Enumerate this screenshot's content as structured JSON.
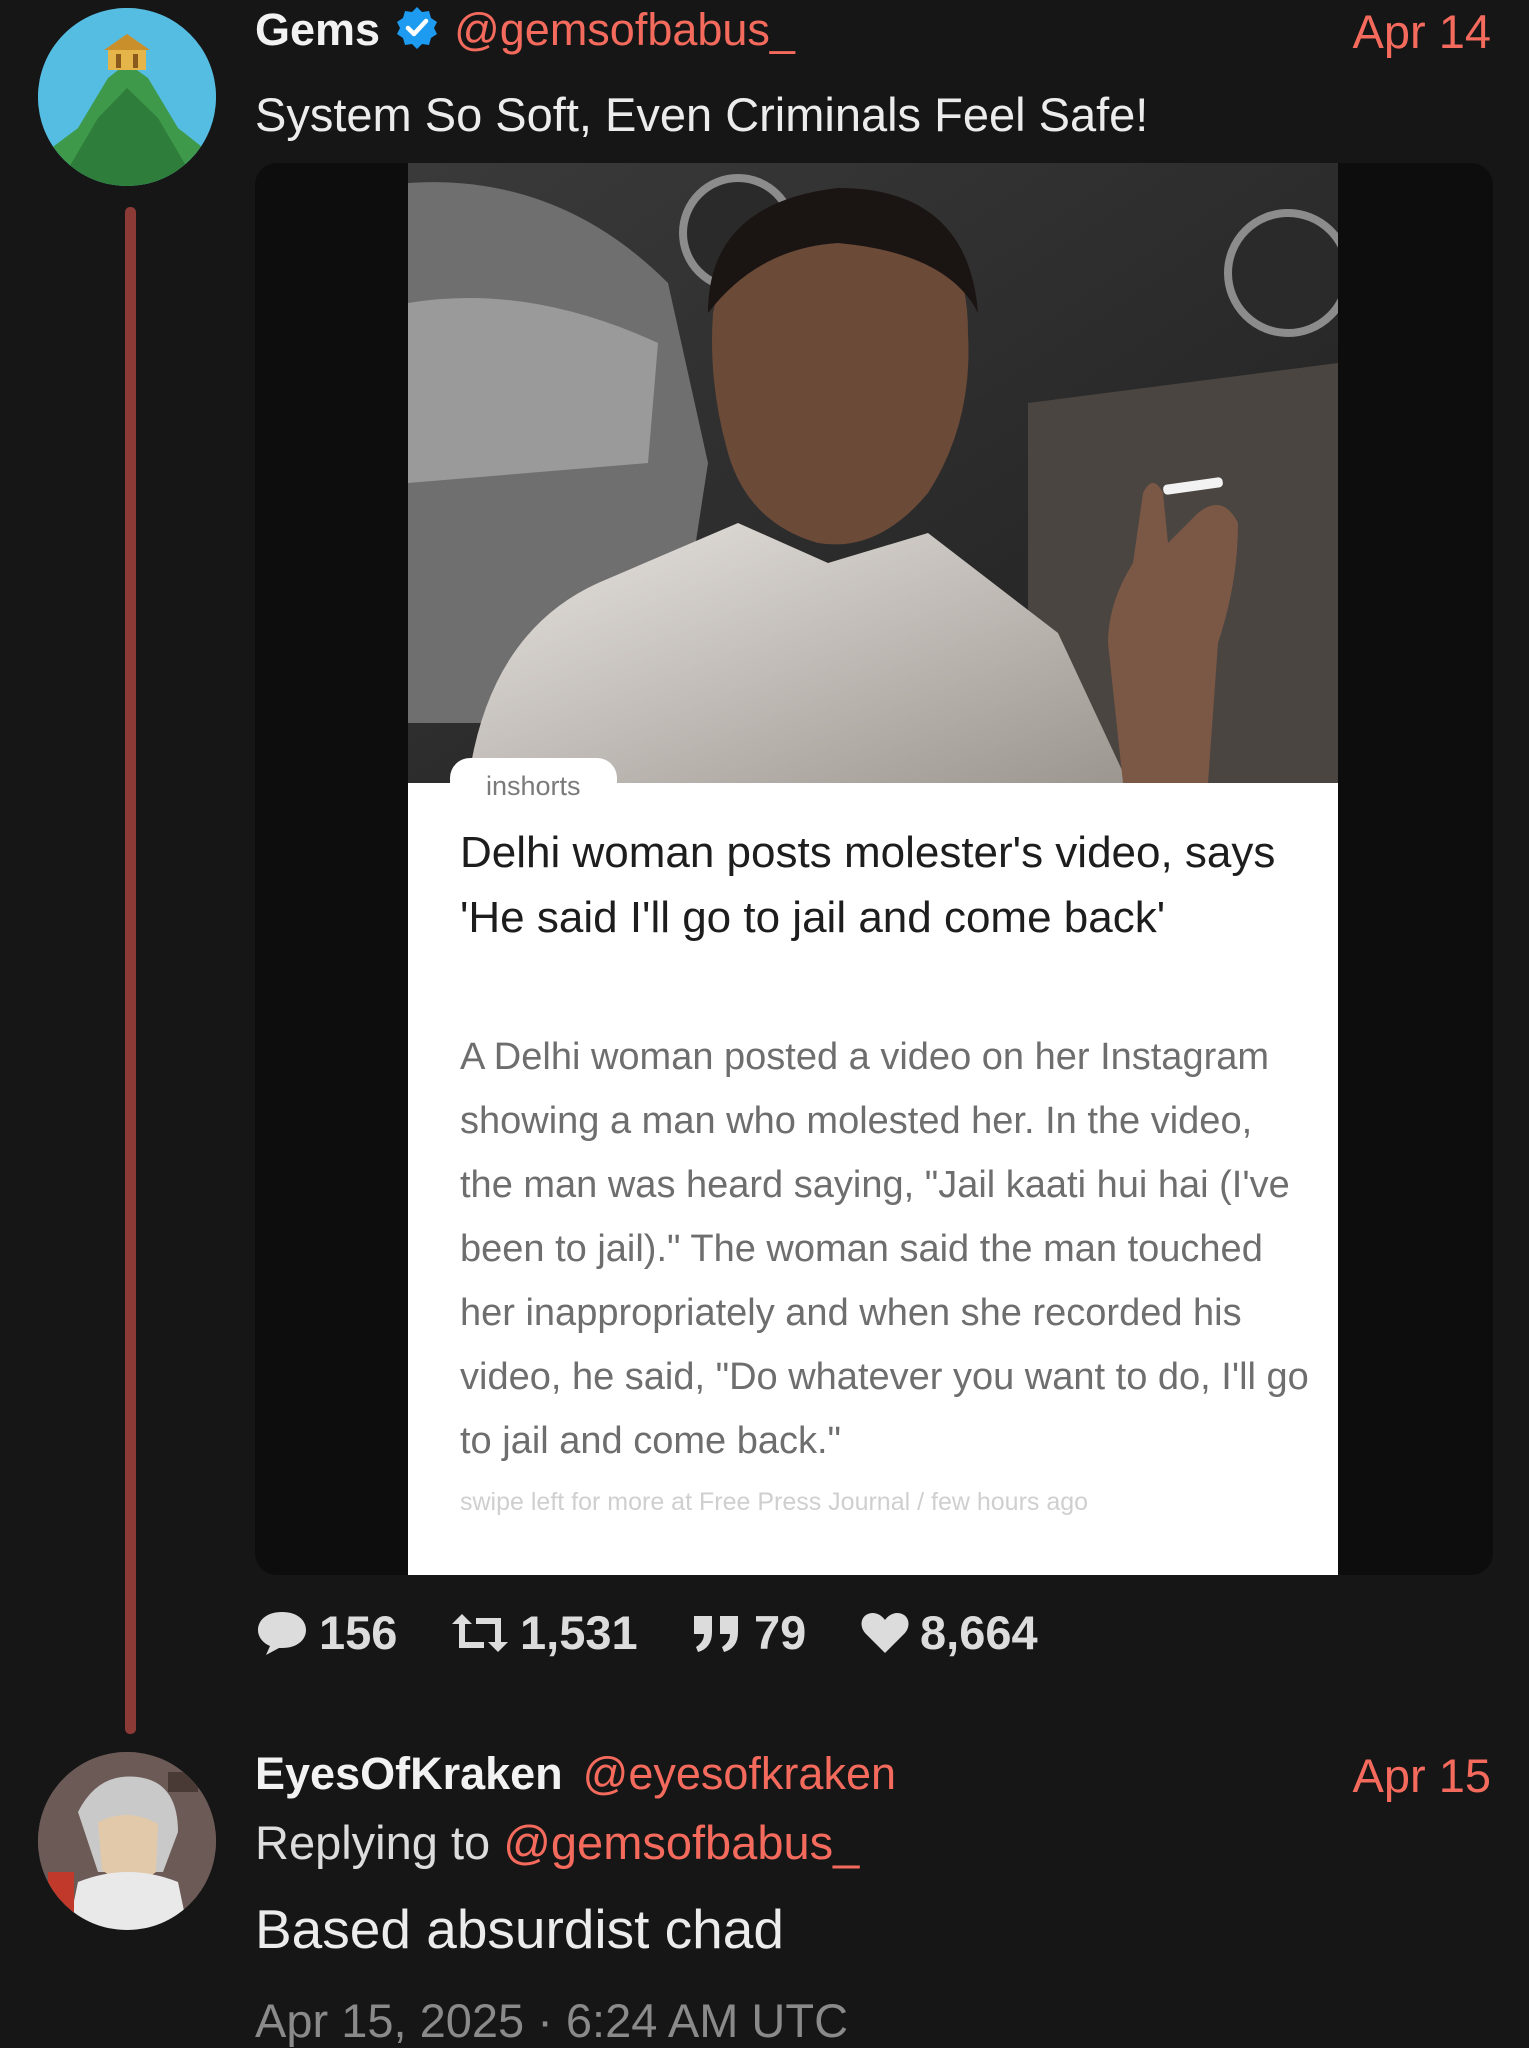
{
  "tweet": {
    "author_name": "Gems",
    "author_handle": "@gemsofbabus_",
    "date": "Apr 14",
    "text": "System So Soft, Even Criminals Feel Safe!",
    "card": {
      "source": "inshorts",
      "headline": "Delhi woman posts molester's video, says 'He said I'll go to jail and come back'",
      "body": "A Delhi woman posted a video on her Instagram showing a man who molested her. In the video, the man was heard saying, \"Jail kaati hui hai (I've been to jail).\" The woman said the man touched her inappropriately and when she recorded his video, he said, \"Do whatever you want to do, I'll go to jail and come back.\"",
      "footer": "swipe left for more at Free Press Journal / few hours ago"
    },
    "stats": {
      "comments": "156",
      "retweets": "1,531",
      "quotes": "79",
      "likes": "8,664"
    }
  },
  "reply": {
    "author_name": "EyesOfKraken",
    "author_handle": "@eyesofkraken",
    "date": "Apr 15",
    "replying_prefix": "Replying to",
    "replying_handle": "@gemsofbabus_",
    "text": "Based absurdist chad",
    "timestamp": "Apr 15, 2025 · 6:24 AM UTC"
  },
  "colors": {
    "accent": "#f46a5c",
    "verified": "#1d9bf0",
    "thread_line": "#8b3a36",
    "background": "#161616"
  },
  "icons": [
    "verified-badge-icon",
    "comment-icon",
    "retweet-icon",
    "quote-icon",
    "heart-icon"
  ]
}
